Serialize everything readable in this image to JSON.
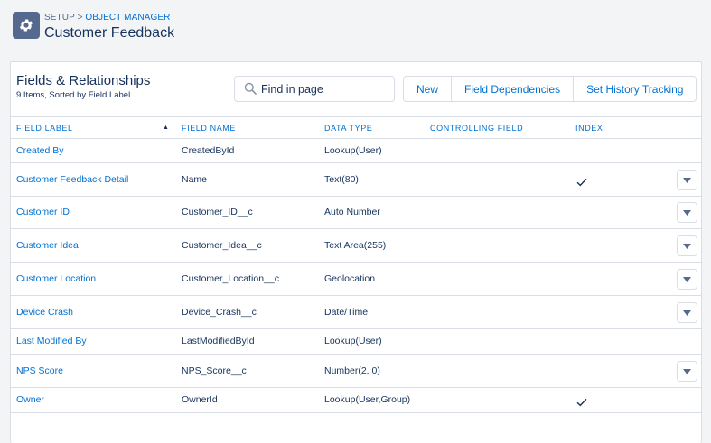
{
  "breadcrumb": {
    "setup": "SETUP",
    "separator": ">",
    "object_manager": "OBJECT MANAGER"
  },
  "page_title": "Customer Feedback",
  "card": {
    "title": "Fields & Relationships",
    "subtitle": "9 Items, Sorted by Field Label"
  },
  "search": {
    "placeholder": "Find in page",
    "value": ""
  },
  "buttons": {
    "new": "New",
    "field_dependencies": "Field Dependencies",
    "history_tracking": "Set History Tracking"
  },
  "columns": {
    "field_label": "FIELD LABEL",
    "field_name": "FIELD NAME",
    "data_type": "DATA TYPE",
    "controlling_field": "CONTROLLING FIELD",
    "index": "INDEX"
  },
  "sort_indicator": "▲",
  "check_glyph": "✓",
  "menu_glyph": "▼",
  "rows": [
    {
      "label": "Created By",
      "name": "CreatedById",
      "type": "Lookup(User)",
      "controlling": "",
      "indexed": false,
      "has_menu": false
    },
    {
      "label": "Customer Feedback Detail",
      "name": "Name",
      "type": "Text(80)",
      "controlling": "",
      "indexed": true,
      "has_menu": true
    },
    {
      "label": "Customer ID",
      "name": "Customer_ID__c",
      "type": "Auto Number",
      "controlling": "",
      "indexed": false,
      "has_menu": true
    },
    {
      "label": "Customer Idea",
      "name": "Customer_Idea__c",
      "type": "Text Area(255)",
      "controlling": "",
      "indexed": false,
      "has_menu": true
    },
    {
      "label": "Customer Location",
      "name": "Customer_Location__c",
      "type": "Geolocation",
      "controlling": "",
      "indexed": false,
      "has_menu": true
    },
    {
      "label": "Device Crash",
      "name": "Device_Crash__c",
      "type": "Date/Time",
      "controlling": "",
      "indexed": false,
      "has_menu": true
    },
    {
      "label": "Last Modified By",
      "name": "LastModifiedById",
      "type": "Lookup(User)",
      "controlling": "",
      "indexed": false,
      "has_menu": false
    },
    {
      "label": "NPS Score",
      "name": "NPS_Score__c",
      "type": "Number(2, 0)",
      "controlling": "",
      "indexed": false,
      "has_menu": true
    },
    {
      "label": "Owner",
      "name": "OwnerId",
      "type": "Lookup(User,Group)",
      "controlling": "",
      "indexed": true,
      "has_menu": false
    }
  ],
  "colors": {
    "link": "#0070d2",
    "text": "#16325c",
    "icon_bg": "#54698d",
    "border": "#d8dde6",
    "page_bg": "#f3f4f6"
  },
  "icons": {
    "setup": "gear-icon",
    "search": "search-icon",
    "row_action": "chevron-down-icon",
    "indexed": "check-icon"
  }
}
